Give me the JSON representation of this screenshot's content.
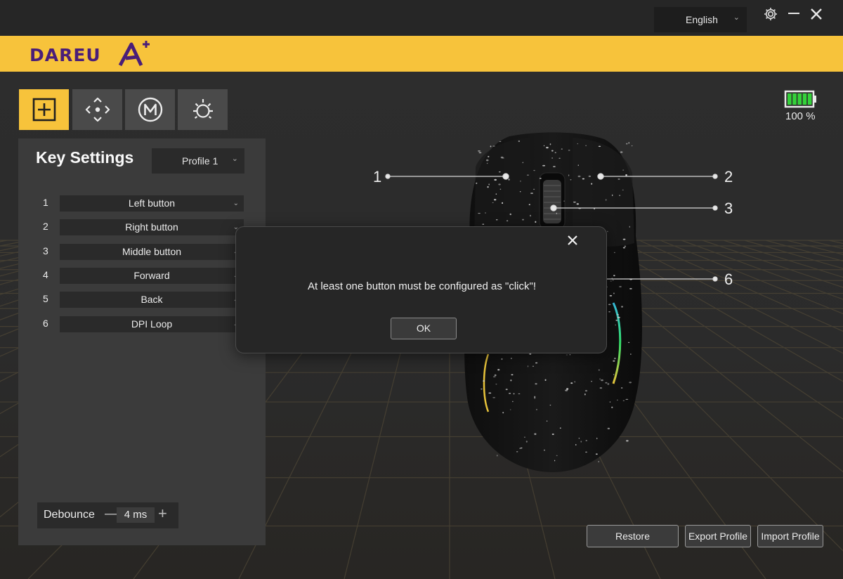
{
  "titlebar": {
    "language": "English",
    "icons": [
      "gear-icon",
      "minimize-icon",
      "close-icon"
    ]
  },
  "header": {
    "logo_text": "DAREU",
    "brand_color": "#f7c33b",
    "logo_color": "#4a1e78"
  },
  "tools": [
    {
      "name": "key-settings",
      "icon": "plus-square-icon",
      "active": true
    },
    {
      "name": "dpi",
      "icon": "move-arrows-icon",
      "active": false
    },
    {
      "name": "macro",
      "icon": "macro-m-icon",
      "active": false
    },
    {
      "name": "lighting",
      "icon": "sun-icon",
      "active": false
    }
  ],
  "battery": {
    "level": 1.0,
    "label": "100 %",
    "color": "#34d23a"
  },
  "panel": {
    "title": "Key Settings",
    "profile": "Profile 1",
    "keys": [
      {
        "num": "1",
        "action": "Left button"
      },
      {
        "num": "2",
        "action": "Right button"
      },
      {
        "num": "3",
        "action": "Middle button"
      },
      {
        "num": "4",
        "action": "Forward"
      },
      {
        "num": "5",
        "action": "Back"
      },
      {
        "num": "6",
        "action": "DPI Loop"
      }
    ],
    "debounce": {
      "label": "Debounce",
      "value": "4 ms"
    }
  },
  "callouts": [
    "1",
    "2",
    "3",
    "6"
  ],
  "buttons": {
    "restore": "Restore",
    "export": "Export Profile",
    "import": "Import Profile"
  },
  "dialog": {
    "message": "At least one button must be configured as \"click\"!",
    "ok": "OK"
  }
}
